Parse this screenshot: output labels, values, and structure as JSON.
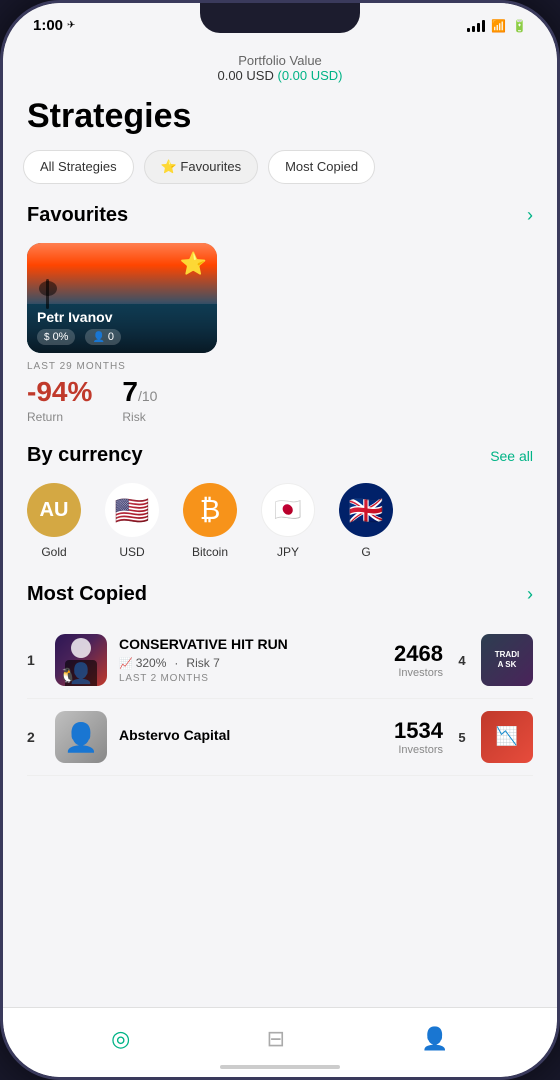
{
  "statusBar": {
    "time": "1:00",
    "timeIcon": "✈",
    "batteryFull": true
  },
  "header": {
    "portfolioLabel": "Portfolio Value",
    "portfolioValue": "0.00 USD",
    "portfolioChange": "(0.00 USD)"
  },
  "page": {
    "title": "Strategies"
  },
  "filterTabs": [
    {
      "id": "all",
      "label": "All Strategies",
      "active": false
    },
    {
      "id": "favourites",
      "label": "⭐ Favourites",
      "active": true
    },
    {
      "id": "most-copied",
      "label": "Most Copied",
      "active": false
    }
  ],
  "favourites": {
    "sectionTitle": "Favourites",
    "card": {
      "name": "Petr Ivanov",
      "profitStat": "0%",
      "copiersStat": "0",
      "duration": "LAST 29 MONTHS",
      "returnValue": "-94%",
      "returnLabel": "Return",
      "riskValue": "7",
      "riskTotal": "/10",
      "riskLabel": "Risk"
    }
  },
  "byCurrency": {
    "sectionTitle": "By currency",
    "seeAllLabel": "See all",
    "currencies": [
      {
        "id": "gold",
        "label": "Gold",
        "type": "gold"
      },
      {
        "id": "usd",
        "label": "USD",
        "type": "flag-us"
      },
      {
        "id": "bitcoin",
        "label": "Bitcoin",
        "type": "btc"
      },
      {
        "id": "jpy",
        "label": "JPY",
        "type": "jpy"
      },
      {
        "id": "gbp",
        "label": "G",
        "type": "gbp"
      }
    ]
  },
  "mostCopied": {
    "sectionTitle": "Most Copied",
    "items": [
      {
        "rank": "1",
        "name": "CONSERVATIVE HIT RUN",
        "returnPct": "320%",
        "risk": "Risk 7",
        "duration": "LAST 2 MONTHS",
        "investorsCount": "2468",
        "investorsLabel": "Investors",
        "badge": "4",
        "thumbText": "TRADI\nA SK"
      },
      {
        "rank": "2",
        "name": "Abstervo Capital",
        "returnPct": "",
        "risk": "",
        "duration": "",
        "investorsCount": "1534",
        "investorsLabel": "Investors",
        "badge": "5",
        "thumbText": ""
      }
    ]
  },
  "bottomNav": {
    "items": [
      {
        "id": "strategies",
        "icon": "◎",
        "active": true
      },
      {
        "id": "portfolio",
        "icon": "⊟",
        "active": false
      },
      {
        "id": "profile",
        "icon": "👤",
        "active": false
      }
    ]
  }
}
